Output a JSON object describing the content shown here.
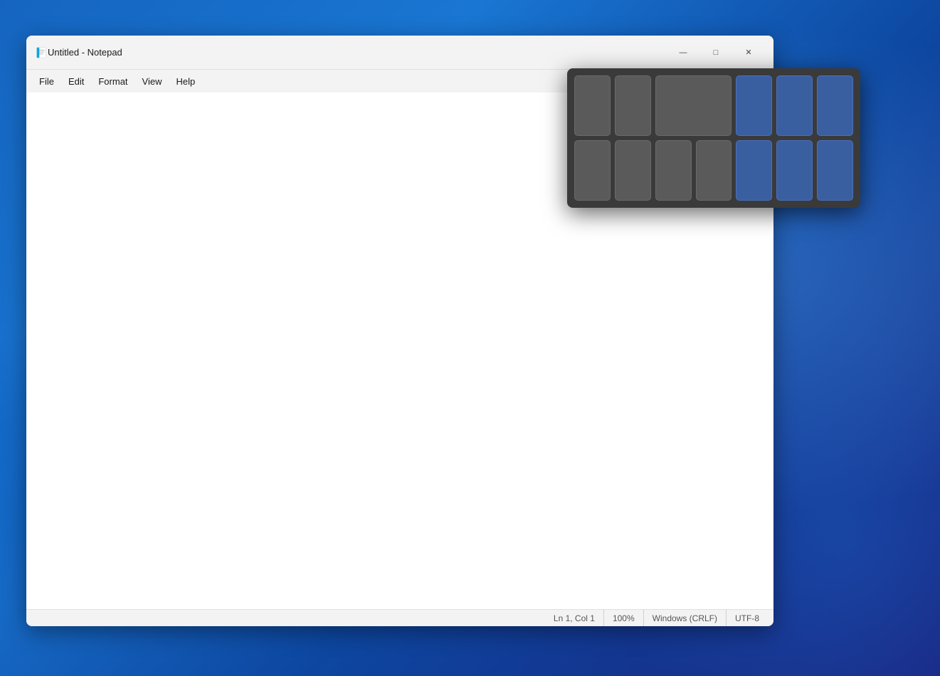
{
  "window": {
    "title": "Untitled - Notepad",
    "icon": "notepad-icon"
  },
  "titlebar": {
    "minimize_label": "—",
    "maximize_label": "□",
    "close_label": "✕"
  },
  "menubar": {
    "items": [
      {
        "id": "file",
        "label": "File"
      },
      {
        "id": "edit",
        "label": "Edit"
      },
      {
        "id": "format",
        "label": "Format"
      },
      {
        "id": "view",
        "label": "View"
      },
      {
        "id": "help",
        "label": "Help"
      }
    ]
  },
  "editor": {
    "content": "",
    "placeholder": ""
  },
  "statusbar": {
    "position": "Ln 1, Col 1",
    "zoom": "100%",
    "line_ending": "Windows (CRLF)",
    "encoding": "UTF-8"
  },
  "fancyzones": {
    "visible": true,
    "rows": 2,
    "cols": 7
  }
}
